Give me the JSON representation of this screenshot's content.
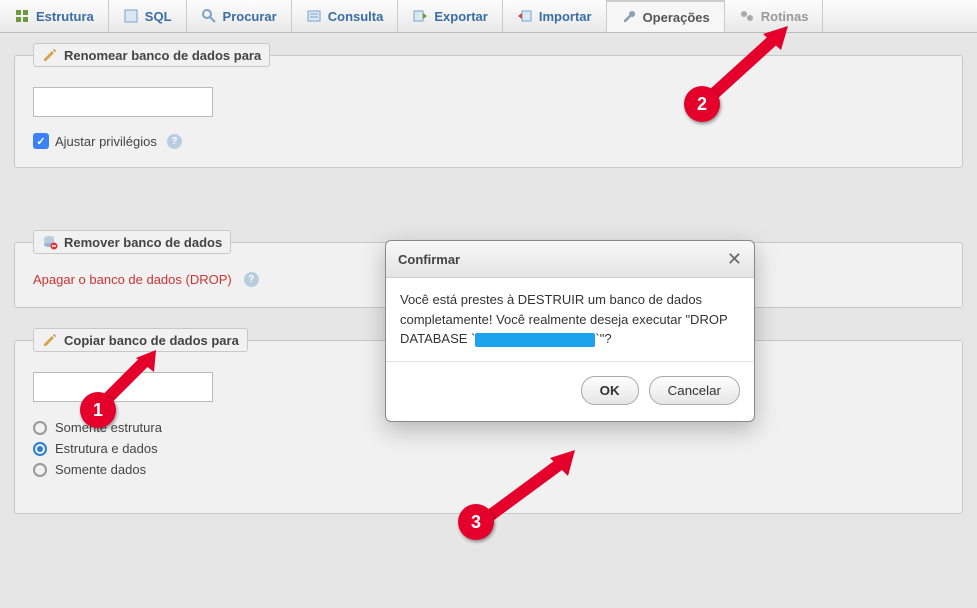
{
  "tabs": {
    "structure": "Estrutura",
    "sql": "SQL",
    "search": "Procurar",
    "query": "Consulta",
    "export": "Exportar",
    "import": "Importar",
    "operations": "Operações",
    "routines": "Rotinas"
  },
  "panels": {
    "rename": {
      "legend": "Renomear banco de dados para",
      "adjust_privileges": "Ajustar privilégios"
    },
    "remove": {
      "legend": "Remover banco de dados",
      "drop_link": "Apagar o banco de dados (DROP)"
    },
    "copy": {
      "legend": "Copiar banco de dados para",
      "opt_structure_only": "Somente estrutura",
      "opt_structure_data": "Estrutura e dados",
      "opt_data_only": "Somente dados"
    }
  },
  "modal": {
    "title": "Confirmar",
    "body_prefix": "Você está prestes à DESTRUIR um banco de dados completamente! Você realmente deseja executar \"DROP DATABASE `",
    "body_suffix": "`\"?",
    "ok": "OK",
    "cancel": "Cancelar"
  },
  "markers": {
    "m1": "1",
    "m2": "2",
    "m3": "3"
  }
}
